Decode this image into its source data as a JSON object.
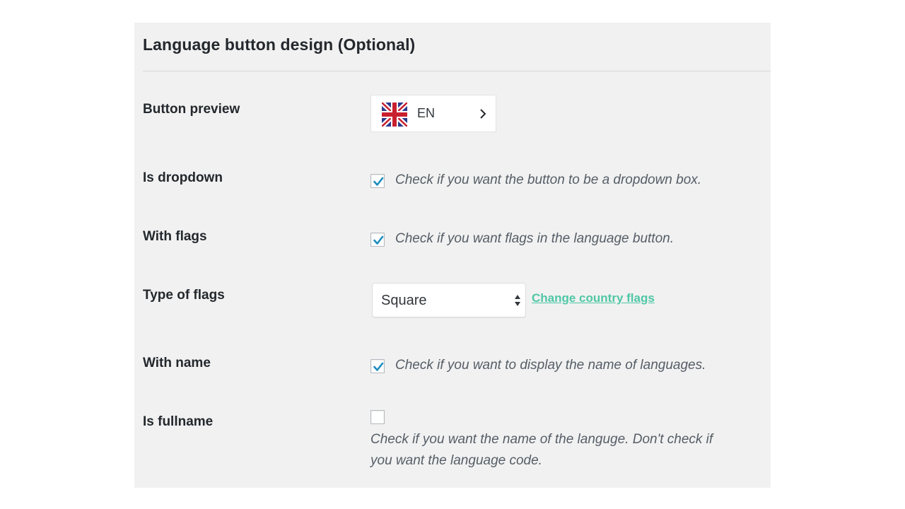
{
  "section": {
    "title": "Language button design (Optional)"
  },
  "rows": {
    "preview": {
      "label": "Button preview",
      "button_code": "EN",
      "flag_icon": "uk-flag-icon",
      "arrow_icon": "chevron-right-icon"
    },
    "dropdown": {
      "label": "Is dropdown",
      "checked": true,
      "description": "Check if you want the button to be a dropdown box."
    },
    "flags": {
      "label": "With flags",
      "checked": true,
      "description": "Check if you want flags in the language button."
    },
    "flag_type": {
      "label": "Type of flags",
      "selected": "Square",
      "link_text": "Change country flags"
    },
    "name": {
      "label": "With name",
      "checked": true,
      "description": "Check if you want to display the name of languages."
    },
    "fullname": {
      "label": "Is fullname",
      "checked": false,
      "description_line1": "Check if you want the name of the languge. Don't check if",
      "description_line2": "you want the language code."
    }
  },
  "colors": {
    "panel_bg": "#f1f1f1",
    "checkmark": "#1e8cbe",
    "link": "#4fc7a5"
  }
}
